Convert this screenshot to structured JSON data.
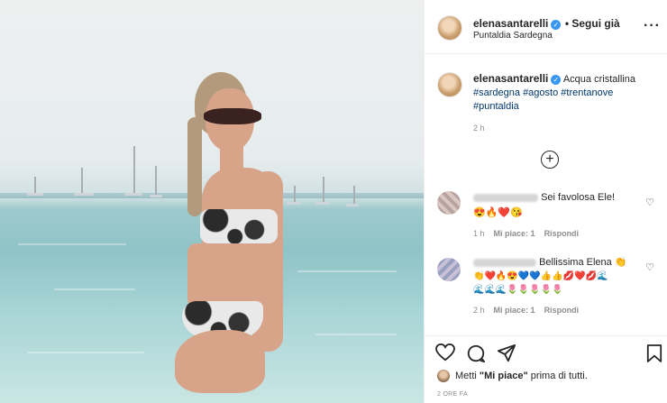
{
  "post": {
    "username": "elenasantarelli",
    "verified_icon": "verified-badge-icon",
    "follow_label": "• Segui già",
    "location": "Puntaldia Sardegna",
    "more_icon": "more-options-icon"
  },
  "caption": {
    "username": "elenasantarelli",
    "text": "Acqua cristallina",
    "hashtags": [
      "#sardegna",
      "#agosto",
      "#trentanove",
      "#puntaldia"
    ],
    "time": "2 h"
  },
  "load_more_icon": "add-circle-icon",
  "comments": [
    {
      "text": "Sei favolosa Ele!",
      "emoji": "😍🔥❤️😘",
      "time": "1 h",
      "likes": "Mi piace: 1",
      "reply": "Rispondi"
    },
    {
      "text": "Bellissima Elena",
      "emoji_line1": "👏",
      "emoji_line2": "👏❤️🔥😍💙💙👍👍💋❤️💋🌊",
      "emoji_line3": "🌊🌊🌊🌷🌷🌷🌷🌷",
      "time": "2 h",
      "likes": "Mi piace: 1",
      "reply": "Rispondi"
    }
  ],
  "actions": {
    "like_icon": "heart-icon",
    "comment_icon": "comment-icon",
    "share_icon": "share-icon",
    "save_icon": "bookmark-icon"
  },
  "likes_prefix": "Metti ",
  "likes_bold": "\"Mi piace\"",
  "likes_suffix": " prima di tutti.",
  "date": "2 ORE FA"
}
